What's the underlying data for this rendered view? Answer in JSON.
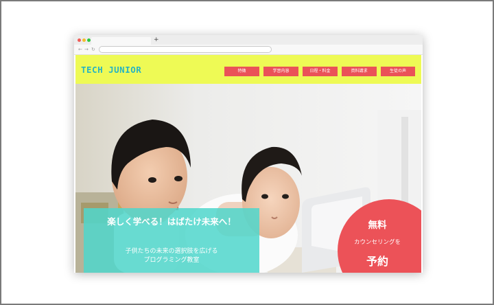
{
  "brand": {
    "logo": "TECH JUNIOR"
  },
  "nav": {
    "items": [
      "特徴",
      "学習内容",
      "日程・料金",
      "資料請求",
      "生徒の声"
    ]
  },
  "hero": {
    "headline": "楽しく学べる！はばたけ未来へ！",
    "subline_1": "子供たちの未来の選択肢を広げる",
    "subline_2": "プログラミング教室",
    "photo": "two-boys-at-laptop-photo"
  },
  "cta": {
    "line_1": "無料",
    "line_2": "カウンセリングを",
    "line_3": "予約"
  },
  "browser": {
    "new_tab": "+"
  },
  "colors": {
    "header_bg": "#eefa55",
    "logo": "#27b4c2",
    "nav_button": "#ea5258",
    "teal_panel": "#50d6cc",
    "cta_circle": "#ec5258"
  }
}
